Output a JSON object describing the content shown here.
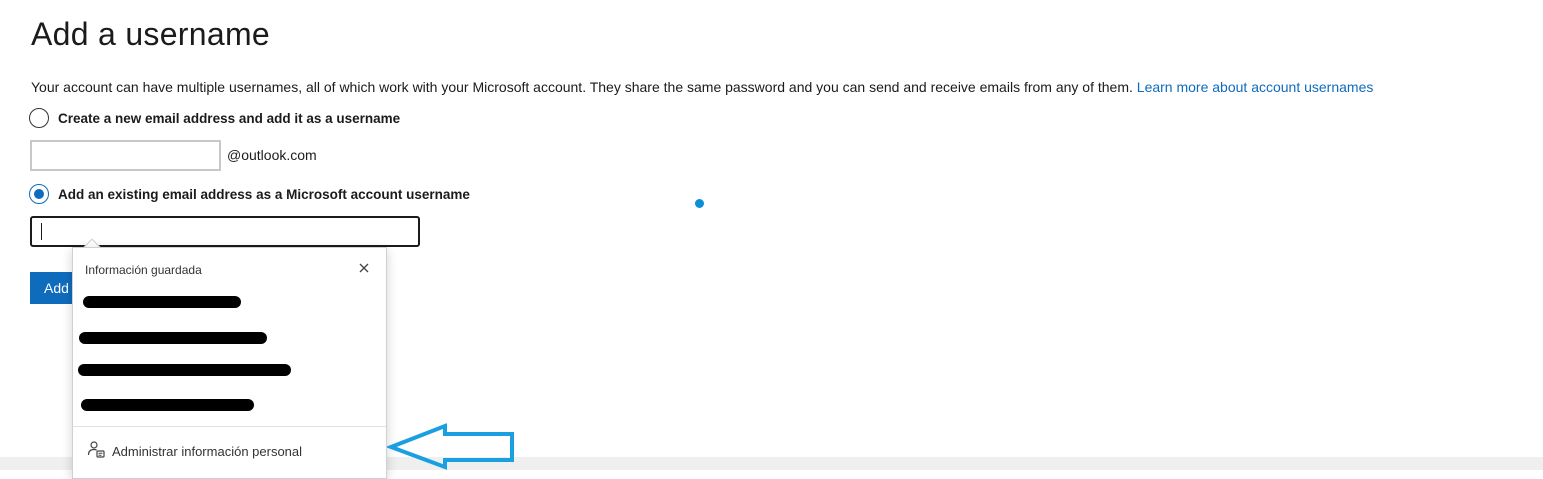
{
  "page": {
    "title": "Add a username",
    "description": "Your account can have multiple usernames, all of which work with your Microsoft account. They share the same password and you can send and receive emails from any of them.",
    "learn_more_link": "Learn more about account usernames"
  },
  "options": {
    "new_email": {
      "label": "Create a new email address and add it as a username",
      "checked": false,
      "input_value": "",
      "domain_suffix": "@outlook.com"
    },
    "existing_email": {
      "label": "Add an existing email address as a Microsoft account username",
      "checked": true,
      "input_value": ""
    }
  },
  "add_button": {
    "label": "Add"
  },
  "autofill_popup": {
    "title": "Información guardada",
    "close_icon": "close-icon",
    "saved_entries_redacted": 4,
    "manage_label": "Administrar información personal",
    "manage_icon": "person-card-icon"
  },
  "colors": {
    "accent": "#0f6cbd",
    "annotation_arrow": "#1a9fe0",
    "redaction": "#000000"
  }
}
